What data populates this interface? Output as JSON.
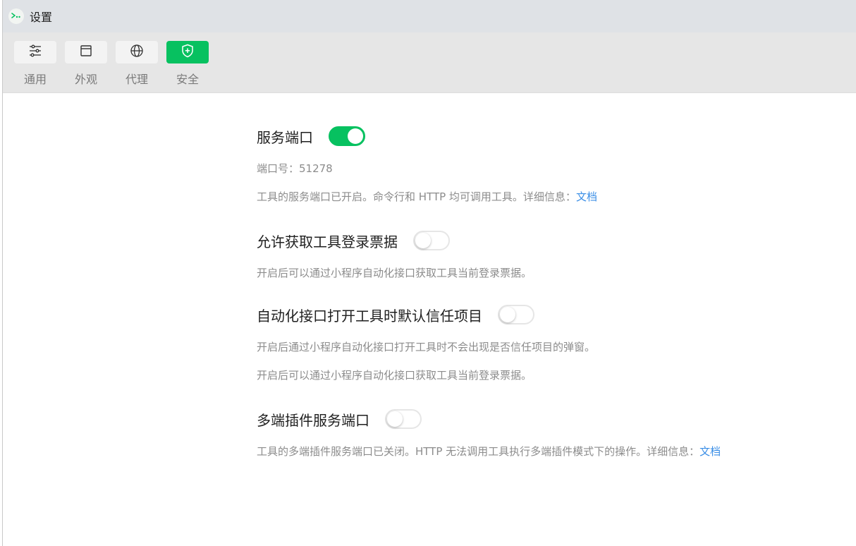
{
  "window": {
    "title": "设置",
    "app_icon": "wechat-devtools-icon"
  },
  "toolbar": {
    "tabs": [
      {
        "label": "通用",
        "icon": "sliders-icon"
      },
      {
        "label": "外观",
        "icon": "window-icon"
      },
      {
        "label": "代理",
        "icon": "globe-icon"
      },
      {
        "label": "安全",
        "icon": "shield-plus-icon",
        "active": true
      }
    ]
  },
  "settings": {
    "service_port": {
      "title": "服务端口",
      "enabled": true,
      "port_text": "端口号：51278",
      "desc": "工具的服务端口已开启。命令行和 HTTP 均可调用工具。详细信息：",
      "link": "文档"
    },
    "login_ticket": {
      "title": "允许获取工具登录票据",
      "enabled": false,
      "desc": "开启后可以通过小程序自动化接口获取工具当前登录票据。"
    },
    "auto_trust": {
      "title": "自动化接口打开工具时默认信任项目",
      "enabled": false,
      "desc1": "开启后通过小程序自动化接口打开工具时不会出现是否信任项目的弹窗。",
      "desc2": "开启后可以通过小程序自动化接口获取工具当前登录票据。"
    },
    "multi_port": {
      "title": "多端插件服务端口",
      "enabled": false,
      "desc": "工具的多端插件服务端口已关闭。HTTP 无法调用工具执行多端插件模式下的操作。详细信息：",
      "link": "文档"
    }
  },
  "colors": {
    "accent": "#07c160",
    "link": "#3a8ee6"
  }
}
